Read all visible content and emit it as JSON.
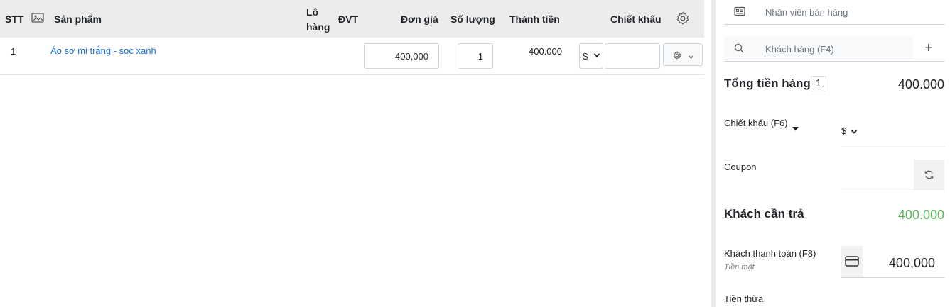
{
  "table": {
    "headers": {
      "stt": "STT",
      "product": "Sản phẩm",
      "lot_line1": "Lô",
      "lot_line2": "hàng",
      "unit": "ĐVT",
      "price": "Đơn giá",
      "quantity": "Số lượng",
      "total": "Thành tiền",
      "discount": "Chiết khấu"
    },
    "rows": [
      {
        "stt": "1",
        "product": "Áo sơ mi trắng - sọc xanh",
        "price": "400,000",
        "quantity": "1",
        "total": "400.000",
        "discount_type": "$",
        "discount_value": ""
      }
    ]
  },
  "sidebar": {
    "employee_placeholder": "Nhân viên bán hàng",
    "customer_placeholder": "Khách hàng (F4)",
    "add_customer_symbol": "+",
    "subtotal_label": "Tổng tiền hàng",
    "subtotal_count": "1",
    "subtotal_amount": "400.000",
    "discount_label": "Chiết khấu (F6)",
    "discount_type": "$",
    "coupon_label": "Coupon",
    "payable_label": "Khách cần trả",
    "payable_amount": "400.000",
    "paid_label": "Khách thanh toán (F8)",
    "paid_method": "Tiền mặt",
    "paid_amount": "400,000",
    "change_label": "Tiền thừa"
  },
  "colors": {
    "link": "#1a73e8",
    "payable": "#5cb85c",
    "header_bg": "#ececec"
  }
}
